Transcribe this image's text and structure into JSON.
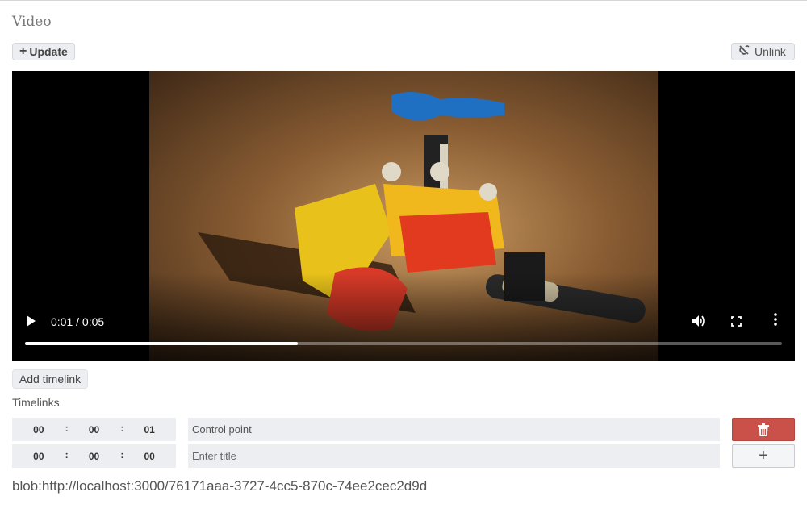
{
  "section": {
    "title": "Video"
  },
  "toolbar": {
    "update_label": "Update",
    "unlink_label": "Unlink"
  },
  "player": {
    "time_display": "0:01 / 0:05",
    "progress": 0.36
  },
  "timelinks": {
    "add_label": "Add timelink",
    "heading": "Timelinks",
    "rows": [
      {
        "hh": "00",
        "mm": "00",
        "ss": "01",
        "title": "Control point",
        "placeholder": "Enter title"
      },
      {
        "hh": "00",
        "mm": "00",
        "ss": "00",
        "title": "",
        "placeholder": "Enter title"
      }
    ]
  },
  "blob_url": "blob:http://localhost:3000/76171aaa-3727-4cc5-870c-74ee2cec2d9d",
  "colors": {
    "delete_button": "#c9514a",
    "input_bg": "#eceef1"
  },
  "icons": [
    "plus-icon",
    "unlink-icon",
    "play-icon",
    "volume-icon",
    "fullscreen-icon",
    "more-vertical-icon",
    "trash-icon"
  ]
}
